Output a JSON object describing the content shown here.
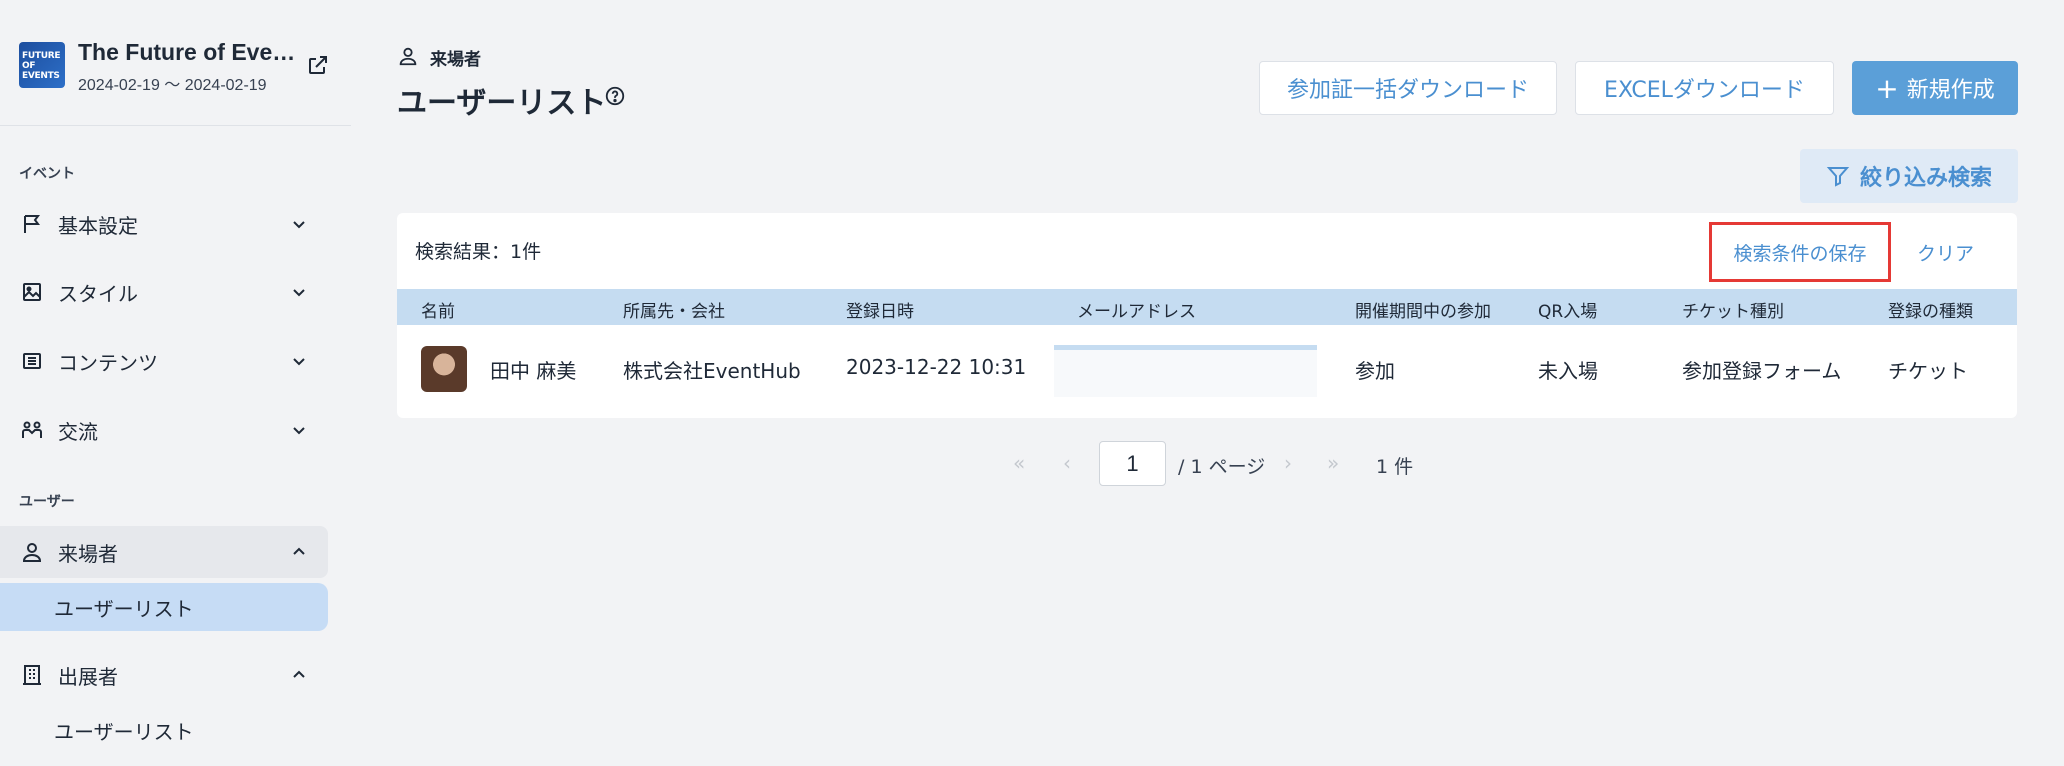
{
  "event": {
    "logo_text": "FUTURE OF EVENTS",
    "title": "The Future of Eve…",
    "dates": "2024-02-19 〜 2024-02-19"
  },
  "sidebar": {
    "section_event": "イベント",
    "section_user": "ユーザー",
    "items": [
      {
        "label": "基本設定",
        "icon": "flag-icon"
      },
      {
        "label": "スタイル",
        "icon": "image-icon"
      },
      {
        "label": "コンテンツ",
        "icon": "list-icon"
      },
      {
        "label": "交流",
        "icon": "people-icon"
      },
      {
        "label": "来場者",
        "icon": "person-icon"
      },
      {
        "label": "出展者",
        "icon": "building-icon"
      }
    ],
    "visitor_sub": "ユーザーリスト",
    "exhibitor_sub": "ユーザーリスト"
  },
  "header": {
    "crumb": "来場者",
    "title": "ユーザーリスト"
  },
  "toolbar": {
    "bulk_download": "参加証一括ダウンロード",
    "excel_download": "EXCELダウンロード",
    "create": "新規作成",
    "filter": "絞り込み検索"
  },
  "results": {
    "count_label": "検索結果：1件",
    "save_condition": "検索条件の保存",
    "clear": "クリア"
  },
  "table": {
    "columns": [
      "名前",
      "所属先・会社",
      "登録日時",
      "メールアドレス",
      "開催期間中の参加",
      "QR入場",
      "チケット種別",
      "登録の種類"
    ],
    "rows": [
      {
        "name": "田中 麻美",
        "company": "株式会社EventHub",
        "registered": "2023-12-22 10:31",
        "email": "",
        "participation": "参加",
        "qr": "未入場",
        "ticket": "参加登録フォーム",
        "reg_type": "チケット"
      }
    ]
  },
  "pagination": {
    "current": "1",
    "total_pages": "/ 1 ページ",
    "total_count": "1 件"
  },
  "colors": {
    "accent": "#4a8fd0",
    "primary_button": "#5b9fd8",
    "table_header": "#c5dcf1",
    "active_nav": "#c6dcf5",
    "highlight_border": "#e53935"
  }
}
